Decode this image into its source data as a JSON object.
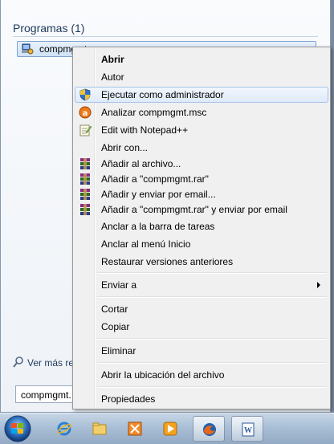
{
  "start_menu": {
    "section_title": "Programas (1)",
    "result_label": "compmgmt",
    "see_more": "Ver más res",
    "search_value": "compmgmt."
  },
  "context_menu": {
    "items": [
      {
        "label": "Abrir",
        "bold": true
      },
      {
        "label": "Autor"
      },
      {
        "label": "Ejecutar como administrador",
        "icon": "shield-icon"
      },
      {
        "label": "Analizar compmgmt.msc",
        "icon": "antivirus-icon"
      },
      {
        "label": "Edit with Notepad++",
        "icon": "notepad-icon"
      },
      {
        "label": "Abrir con..."
      },
      {
        "label": "Añadir al archivo...",
        "icon": "winrar-icon"
      },
      {
        "label": "Añadir a \"compmgmt.rar\"",
        "icon": "winrar-icon"
      },
      {
        "label": "Añadir y enviar por email...",
        "icon": "winrar-icon"
      },
      {
        "label": "Añadir a \"compmgmt.rar\" y enviar por email",
        "icon": "winrar-icon"
      },
      {
        "label": "Anclar a la barra de tareas"
      },
      {
        "label": "Anclar al menú Inicio"
      },
      {
        "label": "Restaurar versiones anteriores"
      },
      {
        "label": "Enviar a",
        "submenu": true
      },
      {
        "label": "Cortar"
      },
      {
        "label": "Copiar"
      },
      {
        "label": "Eliminar"
      },
      {
        "label": "Abrir la ubicación del archivo"
      },
      {
        "label": "Propiedades"
      }
    ]
  },
  "taskbar": {
    "buttons": [
      {
        "icon": "internet-explorer-icon"
      },
      {
        "icon": "folder-icon"
      },
      {
        "icon": "media-center-icon"
      },
      {
        "icon": "media-player-icon"
      },
      {
        "icon": "firefox-icon"
      },
      {
        "icon": "word-icon"
      }
    ]
  }
}
